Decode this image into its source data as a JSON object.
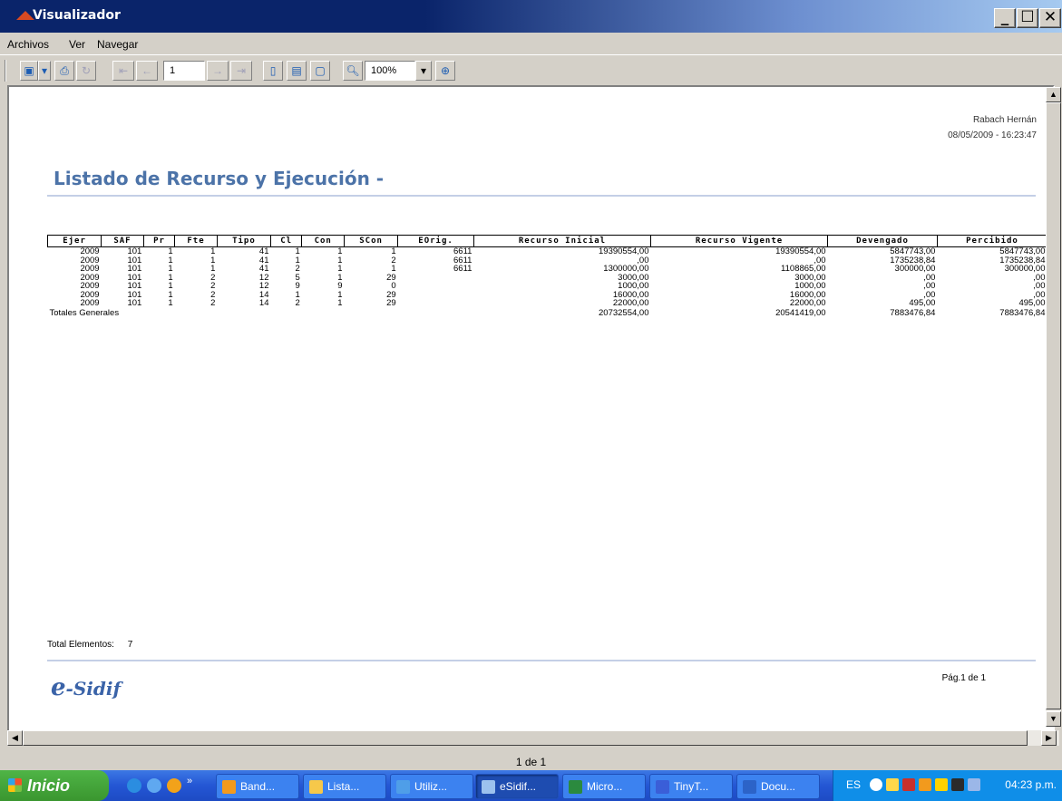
{
  "window": {
    "title": "Visualizador",
    "min": "_",
    "max": "☐",
    "close": "✕"
  },
  "menu": [
    "Archivos",
    "Ver",
    "Navegar"
  ],
  "toolbar": {
    "page": "1",
    "zoom": "100%"
  },
  "report": {
    "user": "Rabach Hernán",
    "datetime": "08/05/2009 - 16:23:47",
    "title": "Listado de Recurso y Ejecución -",
    "columns": [
      "Ejer",
      "SAF",
      "Pr",
      "Fte",
      "Tipo",
      "Cl",
      "Con",
      "SCon",
      "EOrig.",
      "Recurso Inicial",
      "Recurso Vigente",
      "Devengado",
      "Percibido"
    ],
    "rows": [
      [
        "2009",
        "101",
        "1",
        "1",
        "41",
        "1",
        "1",
        "1",
        "6611",
        "19390554,00",
        "19390554,00",
        "5847743,00",
        "5847743,00"
      ],
      [
        "2009",
        "101",
        "1",
        "1",
        "41",
        "1",
        "1",
        "2",
        "6611",
        ",00",
        ",00",
        "1735238,84",
        "1735238,84"
      ],
      [
        "2009",
        "101",
        "1",
        "1",
        "41",
        "2",
        "1",
        "1",
        "6611",
        "1300000,00",
        "1108865,00",
        "300000,00",
        "300000,00"
      ],
      [
        "2009",
        "101",
        "1",
        "2",
        "12",
        "5",
        "1",
        "29",
        "",
        "3000,00",
        "3000,00",
        ",00",
        ",00"
      ],
      [
        "2009",
        "101",
        "1",
        "2",
        "12",
        "9",
        "9",
        "0",
        "",
        "1000,00",
        "1000,00",
        ",00",
        ",00"
      ],
      [
        "2009",
        "101",
        "1",
        "2",
        "14",
        "1",
        "1",
        "29",
        "",
        "16000,00",
        "16000,00",
        ",00",
        ",00"
      ],
      [
        "2009",
        "101",
        "1",
        "2",
        "14",
        "2",
        "1",
        "29",
        "",
        "22000,00",
        "22000,00",
        "495,00",
        "495,00"
      ]
    ],
    "totals": {
      "label": "Totales Generales",
      "recurso_inicial": "20732554,00",
      "recurso_vigente": "20541419,00",
      "devengado": "7883476,84",
      "percibido": "7883476,84"
    },
    "total_elements_label": "Total Elementos:",
    "total_elements": "7",
    "logo_e": "e",
    "logo_text": "-Sidif",
    "page_label": "Pág.1 de 1"
  },
  "status": {
    "page": "1 de 1"
  },
  "taskbar": {
    "start": "Inicio",
    "tasks": [
      "Band...",
      "Lista...",
      "Utiliz...",
      "eSidif...",
      "Micro...",
      "TinyT...",
      "Docu..."
    ],
    "lang": "ES",
    "clock": "04:23 p.m."
  }
}
